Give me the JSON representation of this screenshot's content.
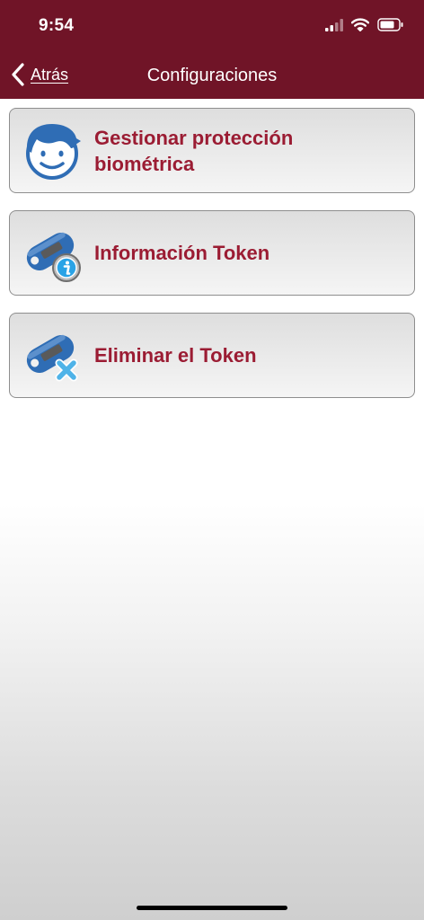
{
  "status_bar": {
    "time": "9:54"
  },
  "nav": {
    "back_label": "Atrás",
    "title": "Configuraciones"
  },
  "menu": {
    "items": [
      {
        "label": "Gestionar protección biométrica",
        "icon": "face-icon"
      },
      {
        "label": "Información Token",
        "icon": "token-info-icon"
      },
      {
        "label": "Eliminar el Token",
        "icon": "token-delete-icon"
      }
    ]
  },
  "colors": {
    "header": "#701427",
    "label": "#9b1c33",
    "icon_blue": "#2f6db5"
  }
}
